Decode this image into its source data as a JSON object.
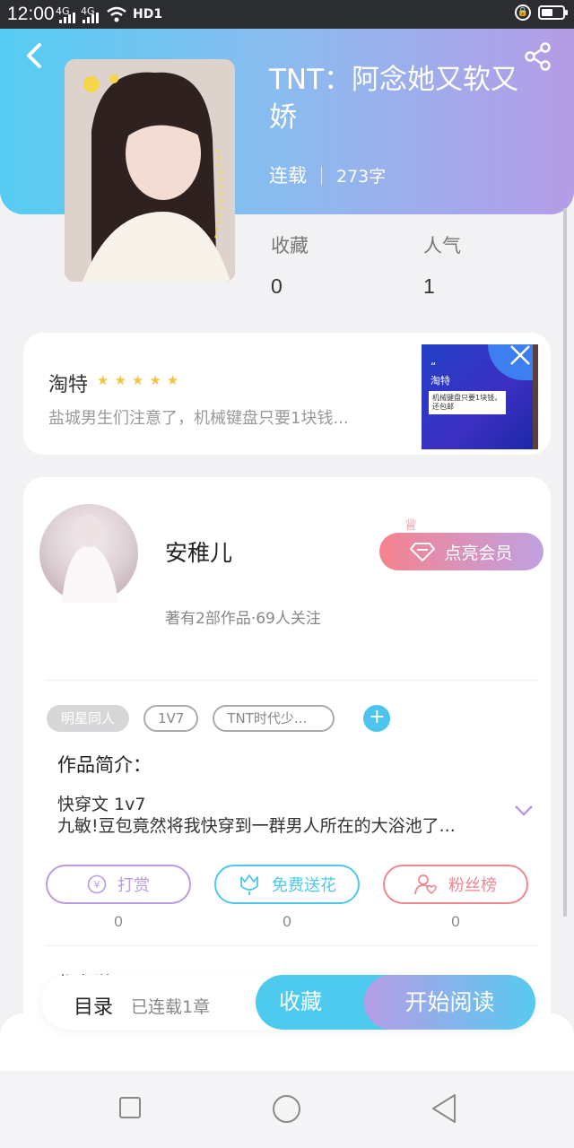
{
  "status_bar": {
    "time": "12:00",
    "signal1": "4G",
    "signal2": "4G",
    "network": "HD1",
    "battery_level": 0.55
  },
  "book": {
    "title": "TNT：阿念她又软又娇",
    "status": "连载",
    "word_count": "273字",
    "stats": [
      {
        "label": "收藏",
        "value": "0"
      },
      {
        "label": "人气",
        "value": "1"
      }
    ]
  },
  "ad": {
    "brand": "淘特",
    "stars": "★★★★★",
    "rating": 5,
    "description": "盐城男生们注意了，机械键盘只要1块钱...",
    "thumb_brand": "淘特",
    "thumb_quote": "“",
    "thumb_text": "机械键盘只要1块钱，还包邮"
  },
  "author": {
    "name": "安稚儿",
    "meta": "著有2部作品·69人关注",
    "vip_label": "点亮会员"
  },
  "tags": [
    "明星同人",
    "1V7",
    "TNT时代少..."
  ],
  "intro": {
    "heading": "作品简介：",
    "line1": "快穿文  1v7",
    "line2": "九敏!豆包竟然将我快穿到一群男人所在的大浴池了..."
  },
  "actions": [
    {
      "label": "打赏",
      "value": "0",
      "icon": "yen-coin-icon",
      "color": "#b99be4"
    },
    {
      "label": "免费送花",
      "value": "0",
      "icon": "flower-icon",
      "color": "#4ec7ee"
    },
    {
      "label": "粉丝榜",
      "value": "0",
      "icon": "fan-user-icon",
      "color": "#f08690"
    }
  ],
  "peek_text": "作者说",
  "bottom_bar": {
    "toc": "目录",
    "chapters": "已连载1章",
    "favorite": "收藏",
    "read": "开始阅读"
  },
  "colors": {
    "header_start": "#55cdf2",
    "header_end": "#b59ce6",
    "accent_blue": "#4fcaef"
  }
}
